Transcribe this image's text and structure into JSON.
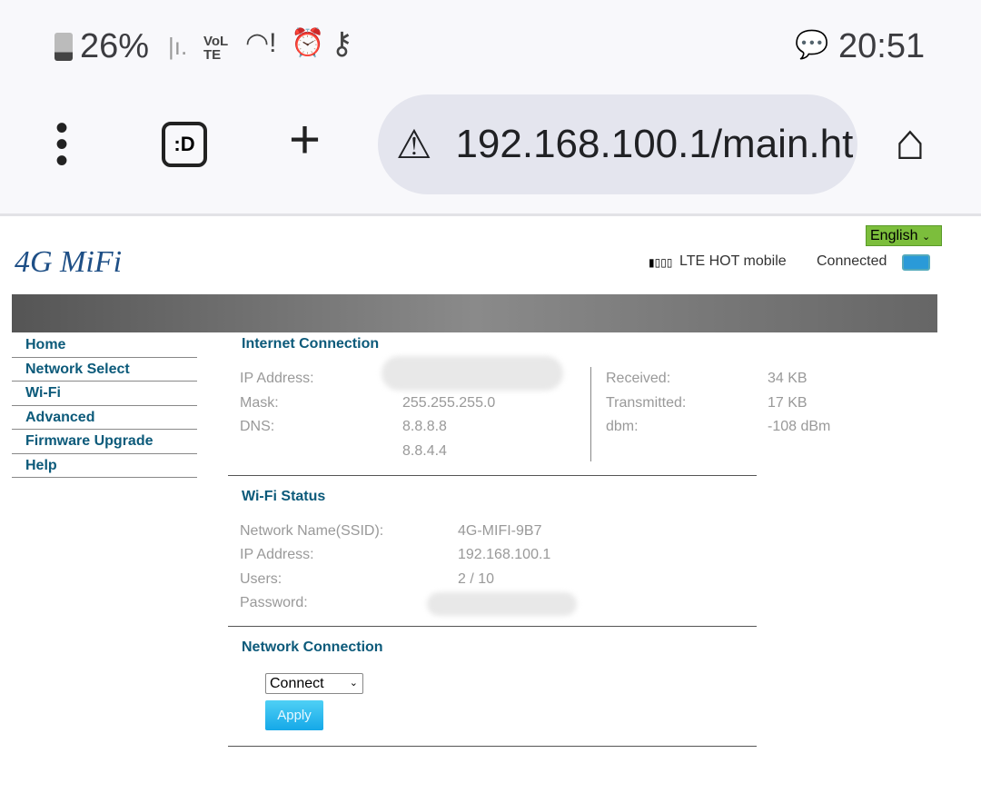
{
  "status_bar": {
    "battery": "26%",
    "network": "VoLTE",
    "time": "20:51",
    "icons": [
      "battery-icon",
      "signal-icon",
      "volte-icon",
      "wifi-alert-icon",
      "alarm-icon",
      "vpn-key-icon",
      "chat-icon"
    ]
  },
  "browser": {
    "url": "192.168.100.1/main.ht",
    "tab_label": ":D",
    "icons": [
      "menu-dots-icon",
      "tab-icon",
      "plus-icon",
      "warning-icon",
      "home-icon"
    ]
  },
  "router": {
    "logo": "4G MiFi",
    "language": "English",
    "carrier": "LTE HOT mobile",
    "connection_status": "Connected",
    "menu": [
      "Home",
      "Network Select",
      "Wi-Fi",
      "Advanced",
      "Firmware Upgrade",
      "Help"
    ],
    "internet": {
      "title": "Internet Connection",
      "left": [
        {
          "label": "IP Address:",
          "value": ""
        },
        {
          "label": "Mask:",
          "value": "255.255.255.0"
        },
        {
          "label": "DNS:",
          "value": "8.8.8.8"
        },
        {
          "label": "",
          "value": "8.8.4.4"
        }
      ],
      "right": [
        {
          "label": "Received:",
          "value": "34 KB"
        },
        {
          "label": "Transmitted:",
          "value": "17 KB"
        },
        {
          "label": "dbm:",
          "value": "-108 dBm"
        }
      ]
    },
    "wifi": {
      "title": "Wi-Fi Status",
      "rows": [
        {
          "label": "Network Name(SSID):",
          "value": "4G-MIFI-9B7"
        },
        {
          "label": "IP Address:",
          "value": "192.168.100.1"
        },
        {
          "label": "Users:",
          "value": "2 / 10"
        },
        {
          "label": "Password:",
          "value": ""
        }
      ]
    },
    "network": {
      "title": "Network Connection",
      "select": "Connect",
      "apply": "Apply"
    }
  }
}
